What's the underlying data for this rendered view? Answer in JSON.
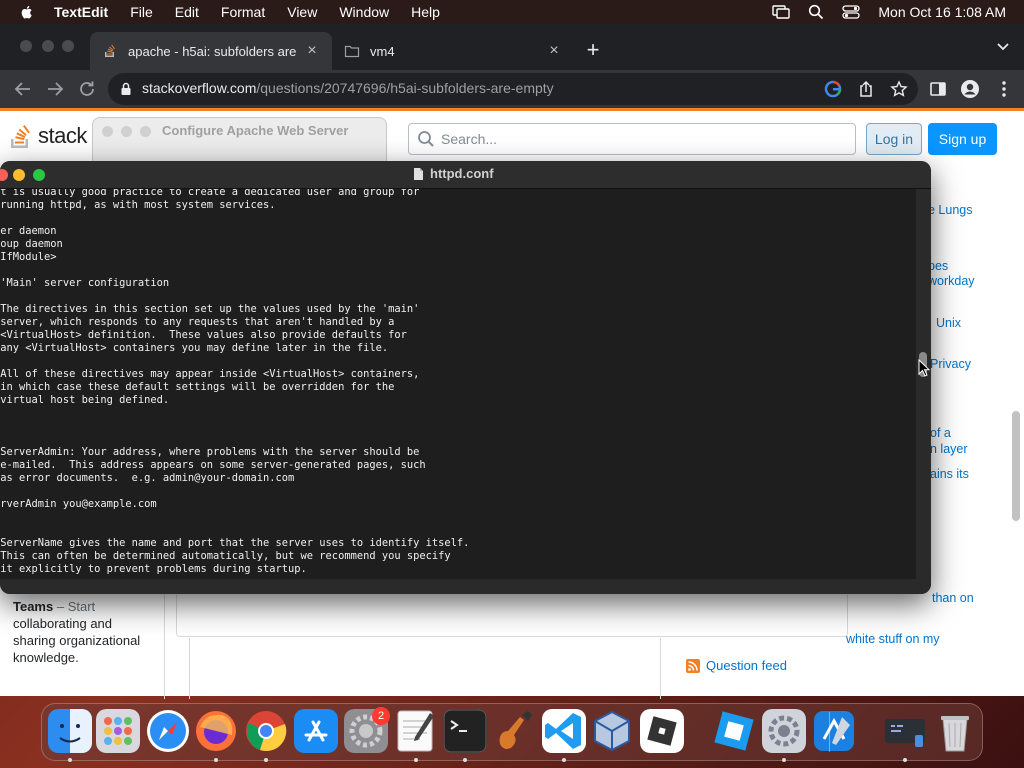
{
  "menubar": {
    "app": "TextEdit",
    "items": [
      "File",
      "Edit",
      "Format",
      "View",
      "Window",
      "Help"
    ],
    "datetime": "Mon Oct 16  1:08 AM"
  },
  "browser": {
    "tabs": [
      {
        "title": "apache - h5ai: subfolders are",
        "active": true
      },
      {
        "title": "vm4",
        "active": false
      }
    ],
    "url_host": "stackoverflow.com",
    "url_path": "/questions/20747696/h5ai-subfolders-are-empty"
  },
  "stackoverflow": {
    "logo_text": "stack ov",
    "search_placeholder": "Search...",
    "login_label": "Log in",
    "signup_label": "Sign up",
    "sidebar_links": [
      "e Lungs",
      "pes",
      "workday",
      "Unix",
      "Privacy",
      "of a",
      "n layer",
      "ains its",
      "than on",
      "white stuff on my"
    ],
    "teams_title": "Teams",
    "teams_rest": " – Start",
    "teams_body": "collaborating and sharing organizational knowledge.",
    "question_feed": "Question feed"
  },
  "config_window": {
    "title": "Configure Apache Web Server"
  },
  "textedit": {
    "filename": "httpd.conf",
    "content": "it is usually good practice to create a dedicated user and group for\n running httpd, as with most system services.\n\nser daemon\nroup daemon\n/IfModule>\n\n 'Main' server configuration\n\n The directives in this section set up the values used by the 'main'\n server, which responds to any requests that aren't handled by a\n <VirtualHost> definition.  These values also provide defaults for\n any <VirtualHost> containers you may define later in the file.\n\n All of these directives may appear inside <VirtualHost> containers,\n in which case these default settings will be overridden for the\n virtual host being defined.\n\n\n\n ServerAdmin: Your address, where problems with the server should be\n e-mailed.  This address appears on some server-generated pages, such\n as error documents.  e.g. admin@your-domain.com\n\nerverAdmin you@example.com\n\n\n ServerName gives the name and port that the server uses to identify itself.\n This can often be determined automatically, but we recommend you specify\n it explicitly to prevent problems during startup."
  },
  "dock": {
    "settings_badge": "2",
    "apps": [
      "finder-icon",
      "launchpad-icon",
      "safari-icon",
      "firefox-icon",
      "chrome-icon",
      "app-store-icon",
      "system-settings-icon",
      "textedit-icon",
      "terminal-icon",
      "garageband-icon",
      "vscode-icon",
      "virtualbox-icon",
      "roblox-icon",
      "roblox-studio-icon",
      "apache-config-icon",
      "xcode-icon",
      "screen-icon",
      "trash-icon"
    ]
  }
}
